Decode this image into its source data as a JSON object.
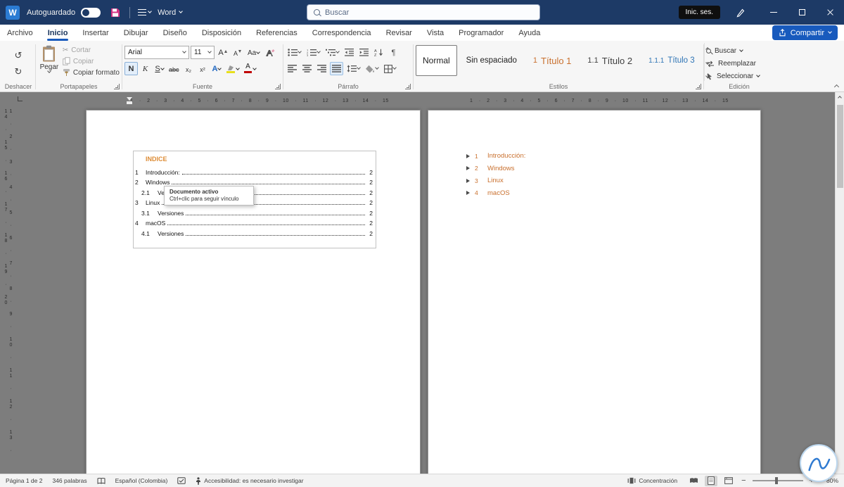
{
  "colors": {
    "titlebar": "#1d3a66",
    "accent": "#185abd",
    "heading-orange": "#c9702e",
    "title-orange": "#dd8c35",
    "heading-blue": "#2e74b5",
    "highlight-yellow": "#e8df1c",
    "font-red": "#c00000"
  },
  "titlebar": {
    "logo_letter": "W",
    "autosave_label": "Autoguardado",
    "app_name": "Word",
    "search_placeholder": "Buscar",
    "signin_label": "Inic. ses."
  },
  "menubar": {
    "tabs": [
      "Archivo",
      "Inicio",
      "Insertar",
      "Dibujar",
      "Diseño",
      "Disposición",
      "Referencias",
      "Correspondencia",
      "Revisar",
      "Vista",
      "Programador",
      "Ayuda"
    ],
    "active_tab": "Inicio",
    "share_label": "Compartir"
  },
  "ribbon": {
    "undo": {
      "group_label": "Deshacer"
    },
    "clipboard": {
      "group_label": "Portapapeles",
      "paste": "Pegar",
      "cut": "Cortar",
      "copy": "Copiar",
      "format_painter": "Copiar formato"
    },
    "font": {
      "group_label": "Fuente",
      "family": "Arial",
      "size": "11",
      "grow": "A",
      "shrink": "A",
      "case": "Aa",
      "bold": "N",
      "italic": "K",
      "underline": "S",
      "strike": "abc",
      "subscript": "x₂",
      "superscript": "x²",
      "effects": "A",
      "color": "A"
    },
    "paragraph": {
      "group_label": "Párrafo"
    },
    "styles": {
      "group_label": "Estilos",
      "items": [
        {
          "prefix": "",
          "label": "Normal"
        },
        {
          "prefix": "",
          "label": "Sin espaciado"
        },
        {
          "prefix": "1",
          "label": "Título 1"
        },
        {
          "prefix": "1.1",
          "label": "Título 2"
        },
        {
          "prefix": "1.1.1",
          "label": "Título 3"
        }
      ]
    },
    "editing": {
      "group_label": "Edición",
      "find": "Buscar",
      "replace": "Reemplazar",
      "select": "Seleccionar"
    }
  },
  "ruler": {
    "horizontal": "1 · 2 · 3 · 4 · 5 · 6 · 7 · 8 · 9 · 10 · 11 · 12 · 13 · 14 · 15",
    "vertical": "1 · 2 · 3 · 4 · 5 · 6 · 7 · 8 · 9 · 10 · 11 · 12 · 13 · 14 · 15 · 16 · 17 · 18 · 19 · 20"
  },
  "document": {
    "toc": {
      "title": "INDICE",
      "entries": [
        {
          "num": "1",
          "label": "Introducción:",
          "page": "2"
        },
        {
          "num": "2",
          "label": "Windows",
          "page": "2"
        },
        {
          "num": "2.1",
          "label": "Versiones",
          "page": "2"
        },
        {
          "num": "3",
          "label": "Linux",
          "page": "2"
        },
        {
          "num": "3.1",
          "label": "Versiones",
          "page": "2"
        },
        {
          "num": "4",
          "label": "macOS",
          "page": "2"
        },
        {
          "num": "4.1",
          "label": "Versiones",
          "page": "2"
        }
      ]
    },
    "tooltip": {
      "title": "Documento activo",
      "hint": "Ctrl+clic para seguir vínculo"
    },
    "headings": [
      {
        "num": "1",
        "label": "Introducción:"
      },
      {
        "num": "2",
        "label": "Windows"
      },
      {
        "num": "3",
        "label": "Linux"
      },
      {
        "num": "4",
        "label": "macOS"
      }
    ]
  },
  "statusbar": {
    "page_info": "Página 1 de 2",
    "word_count": "346 palabras",
    "language": "Español (Colombia)",
    "accessibility": "Accesibilidad: es necesario investigar",
    "focus": "Concentración",
    "zoom_out": "−",
    "zoom_in": "+",
    "zoom_level": "80%"
  }
}
